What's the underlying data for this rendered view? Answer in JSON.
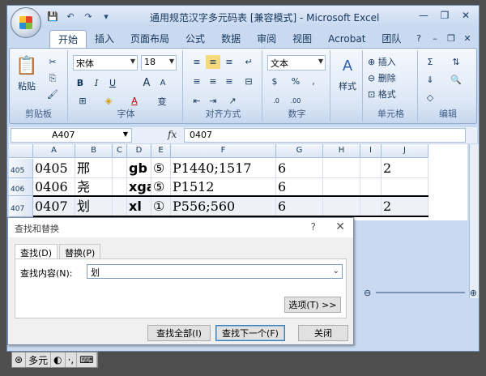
{
  "window": {
    "title": "通用规范汉字多元码表  [兼容模式] - Microsoft Excel",
    "minimize": "—",
    "restore": "❐",
    "close": "✕"
  },
  "ribbon": {
    "tabs": [
      "开始",
      "插入",
      "页面布局",
      "公式",
      "数据",
      "审阅",
      "视图",
      "Acrobat",
      "团队"
    ],
    "groups": {
      "clipboard": {
        "label": "剪贴板",
        "paste": "粘贴"
      },
      "font": {
        "label": "字体",
        "font_name": "宋体",
        "font_size": "18",
        "bold": "B",
        "italic": "I",
        "underline": "U",
        "grow": "A",
        "shrink": "A",
        "wen": "变"
      },
      "alignment": {
        "label": "对齐方式"
      },
      "number": {
        "label": "数字",
        "format": "文本",
        "percent": "%"
      },
      "styles": {
        "label": "样式"
      },
      "cells": {
        "label": "单元格",
        "insert": "插入",
        "delete": "删除",
        "format": "格式"
      },
      "editing": {
        "label": "编辑"
      }
    }
  },
  "formula_bar": {
    "name_box": "A407",
    "fx": "fx",
    "content": "0407"
  },
  "grid": {
    "columns": [
      "A",
      "B",
      "C",
      "D",
      "E",
      "F",
      "G",
      "H",
      "I",
      "J"
    ],
    "rows": [
      {
        "num": "405",
        "cells": [
          "0405",
          "邢",
          "",
          "gb",
          "⑤",
          "P1440;1517",
          "6",
          "",
          "",
          "2"
        ]
      },
      {
        "num": "406",
        "cells": [
          "0406",
          "尧",
          "",
          "xga",
          "⑤",
          "P1512",
          "6",
          "",
          "",
          ""
        ]
      },
      {
        "num": "407",
        "cells": [
          "0407",
          "划",
          "",
          "xl",
          "①",
          "P556;560",
          "6",
          "",
          "",
          "2"
        ]
      }
    ]
  },
  "dialog": {
    "title": "查找和替换",
    "help": "?",
    "close": "✕",
    "tabs": [
      "查找(D)",
      "替换(P)"
    ],
    "find_label": "查找内容(N):",
    "find_value": "划",
    "options": "选项(T) >>",
    "find_all": "查找全部(I)",
    "find_next": "查找下一个(F)",
    "close_button": "关闭"
  },
  "ime": {
    "mode": "多元",
    "moon": "◐",
    "dots": "·,",
    "keyboard": "⌨"
  }
}
